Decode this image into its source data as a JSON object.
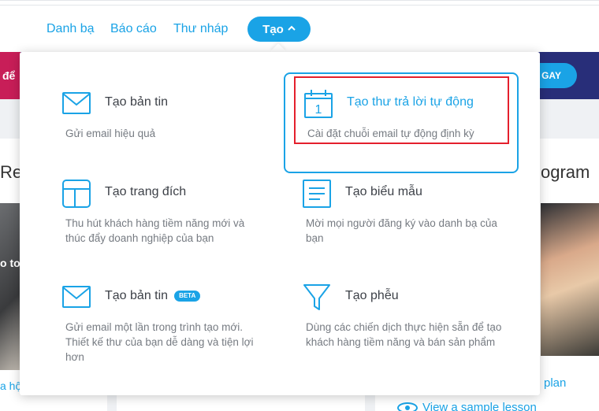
{
  "nav": {
    "links": [
      "Danh bạ",
      "Báo cáo",
      "Thư nháp"
    ],
    "create_label": "Tạo",
    "create_chevron": "^"
  },
  "background": {
    "banner_left_text": "để",
    "banner_button": "GAY",
    "card_left_title": "Re",
    "card_left_photo_text": "o to",
    "card_left_link": "a hộ",
    "card_right_title": "ogram",
    "card_right_link": "plan",
    "card_right_sample": "View a sample lesson"
  },
  "dropdown": {
    "items": [
      {
        "title": "Tạo bản tin",
        "description": "Gửi email hiệu quả",
        "icon": "envelope-icon",
        "active": false
      },
      {
        "title": "Tạo thư trả lời tự động",
        "description": "Cài đặt chuỗi email tự động định kỳ",
        "icon": "calendar-icon",
        "calendar_day": "1",
        "active": true
      },
      {
        "title": "Tạo trang đích",
        "description": "Thu hút khách hàng tiềm năng mới và thúc đẩy doanh nghiệp của bạn",
        "icon": "layout-icon",
        "active": false
      },
      {
        "title": "Tạo biểu mẫu",
        "description": "Mời mọi người đăng ký vào danh bạ của bạn",
        "icon": "form-icon",
        "active": false
      },
      {
        "title": "Tạo bản tin",
        "badge": "BETA",
        "description": "Gửi email một lần trong trình tạo mới. Thiết kế thư của bạn dễ dàng và tiện lợi hơn",
        "icon": "envelope-icon",
        "active": false
      },
      {
        "title": "Tạo phễu",
        "description": "Dùng các chiến dịch thực hiện sẵn để tạo khách hàng tiềm năng và bán sản phẩm",
        "icon": "funnel-icon",
        "active": false
      }
    ]
  },
  "colors": {
    "accent": "#1aa3e6",
    "highlight_box": "#e4202d",
    "banner": "#282e79",
    "banner_left": "#c81e58"
  }
}
